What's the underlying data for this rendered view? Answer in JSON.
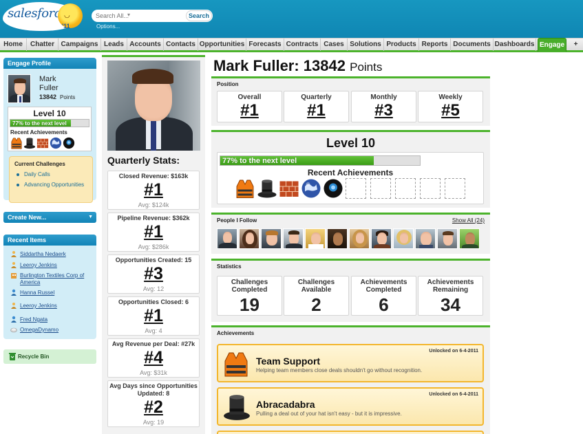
{
  "header": {
    "brand": "salesforce",
    "brand_year": "'11",
    "search_placeholder": "Search All...",
    "search_button": "Search",
    "options_link": "Options..."
  },
  "tabs": [
    "Home",
    "Chatter",
    "Campaigns",
    "Leads",
    "Accounts",
    "Contacts",
    "Opportunities",
    "Forecasts",
    "Contracts",
    "Cases",
    "Solutions",
    "Products",
    "Reports",
    "Documents",
    "Dashboards",
    "Engage",
    "+"
  ],
  "active_tab": "Engage",
  "sidebar": {
    "profile_title": "Engage Profile",
    "first_name": "Mark",
    "last_name": "Fuller",
    "points_value": "13842",
    "points_label": "Points",
    "level": "Level 10",
    "progress_text": "77% to the next level",
    "progress_fraction": 0.77,
    "recent_achievements_label": "Recent Achievements",
    "current_challenges_title": "Current Challenges",
    "challenges": [
      "Daily Calls",
      "Advancing Opportunities"
    ],
    "create_new": "Create New...",
    "recent_items_title": "Recent Items",
    "recent_items": [
      {
        "label": "Siddartha Nedaerk",
        "icon": "lead-icon"
      },
      {
        "label": "Leeroy Jenkins",
        "icon": "lead-icon"
      },
      {
        "label": "Burlington Textiles Corp of America",
        "icon": "account-icon"
      },
      {
        "label": "Hanna Russel",
        "icon": "contact-icon"
      },
      {
        "label": "Leeroy Jenkins",
        "icon": "lead-icon"
      },
      {
        "label": "Fred Ngata",
        "icon": "contact-icon"
      },
      {
        "label": "OmegaDynamo",
        "icon": "opportunity-icon"
      }
    ],
    "recycle_bin": "Recycle Bin"
  },
  "quarterly": {
    "title": "Quarterly Stats:",
    "stats": [
      {
        "label": "Closed Revenue: $163k",
        "rank": "#1",
        "avg": "Avg: $124k"
      },
      {
        "label": "Pipeline Revenue: $362k",
        "rank": "#1",
        "avg": "Avg: $286k"
      },
      {
        "label": "Opportunities Created: 15",
        "rank": "#3",
        "avg": "Avg: 12"
      },
      {
        "label": "Opportunities Closed: 6",
        "rank": "#1",
        "avg": "Avg: 4"
      },
      {
        "label": "Avg Revenue per Deal: #27k",
        "rank": "#4",
        "avg": "Avg: $31k"
      },
      {
        "label": "Avg Days since Opportunities Updated: 8",
        "rank": "#2",
        "avg": "Avg: 19"
      }
    ]
  },
  "main": {
    "name_points": "Mark Fuller: 13842",
    "points_word": "Points",
    "position_title": "Position",
    "positions": [
      {
        "label": "Overall",
        "value": "#1"
      },
      {
        "label": "Quarterly",
        "value": "#1"
      },
      {
        "label": "Monthly",
        "value": "#3"
      },
      {
        "label": "Weekly",
        "value": "#5"
      }
    ],
    "level": "Level 10",
    "progress_text": "77% to the next level",
    "progress_fraction": 0.77,
    "recent_achievements_label": "Recent Achievements",
    "people_title": "People I Follow",
    "show_all": "Show All (24)",
    "statistics_title": "Statistics",
    "statistics": [
      {
        "label": "Challenges Completed",
        "value": "19"
      },
      {
        "label": "Challenges Available",
        "value": "2"
      },
      {
        "label": "Achievements Completed",
        "value": "6"
      },
      {
        "label": "Achievements Remaining",
        "value": "34"
      }
    ],
    "achievements_title": "Achievements",
    "achievements": [
      {
        "name": "Team Support",
        "desc": "Helping team members close deals shouldn't go without recognition.",
        "date": "Unlocked on 6-4-2011",
        "icon": "life-vest-icon"
      },
      {
        "name": "Abracadabra",
        "desc": "Pulling a deal out of your hat isn't easy - but it is impressive.",
        "date": "Unlocked on 6-4-2011",
        "icon": "top-hat-icon"
      }
    ]
  },
  "colors": {
    "header_blue": "#1797c0",
    "accent_green": "#4bb32b",
    "sidebar_blue": "#d2edf7",
    "achievement_gold": "#f3b62c"
  }
}
